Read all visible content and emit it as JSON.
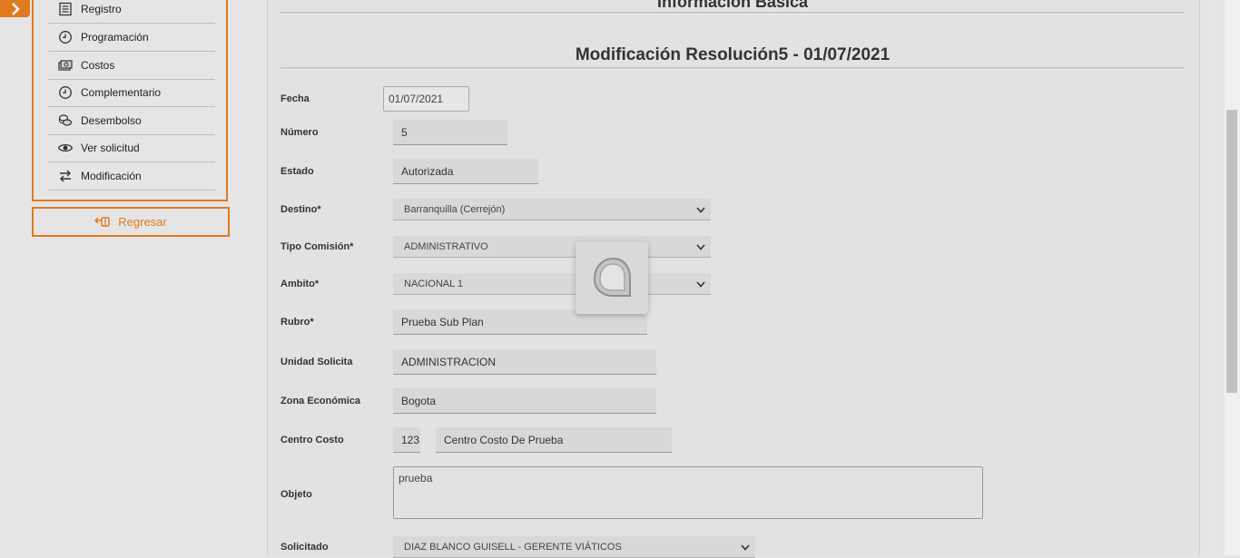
{
  "sidebar": {
    "items": [
      {
        "label": "Registro",
        "icon": "list-icon"
      },
      {
        "label": "Programación",
        "icon": "clock-icon"
      },
      {
        "label": "Costos",
        "icon": "money-icon"
      },
      {
        "label": "Complementario",
        "icon": "clock-icon"
      },
      {
        "label": "Desembolso",
        "icon": "coins-icon"
      },
      {
        "label": "Ver solicitud",
        "icon": "eye-icon"
      },
      {
        "label": "Modificación",
        "icon": "swap-arrows-icon"
      }
    ],
    "back_label": "Regresar"
  },
  "main": {
    "top_title": "Información Básica",
    "section_title": "Modificación Resolución5 - 01/07/2021",
    "fields": {
      "fecha": {
        "label": "Fecha",
        "value": "01/07/2021"
      },
      "numero": {
        "label": "Número",
        "value": "5"
      },
      "estado": {
        "label": "Estado",
        "value": "Autorizada"
      },
      "destino": {
        "label": "Destino*",
        "value": "Barranquilla (Cerrejón)"
      },
      "tipo_comision": {
        "label": "Tipo Comisión*",
        "value": "ADMINISTRATIVO"
      },
      "ambito": {
        "label": "Ambito*",
        "value": "NACIONAL 1"
      },
      "rubro": {
        "label": "Rubro*",
        "value": "Prueba Sub Plan"
      },
      "unidad": {
        "label": "Unidad Solicita",
        "value": "ADMINISTRACION"
      },
      "zona": {
        "label": "Zona Económica",
        "value": "Bogota"
      },
      "centro_costo": {
        "label": "Centro Costo",
        "code": "123",
        "name": "Centro Costo De Prueba"
      },
      "objeto": {
        "label": "Objeto",
        "value": "prueba"
      },
      "solicitado": {
        "label": "Solicitado",
        "value": "DIAZ BLANCO GUISELL - GERENTE VIÁTICOS"
      }
    }
  },
  "colors": {
    "accent": "#e07a1f",
    "panel": "#e2e2e2",
    "field": "#d8d8d8"
  }
}
